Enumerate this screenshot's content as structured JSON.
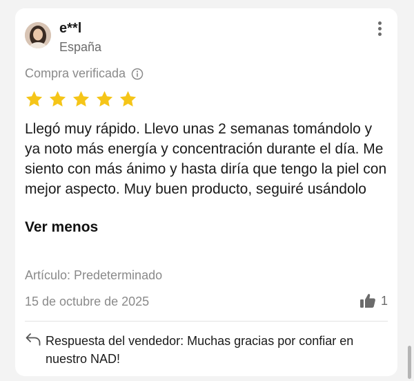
{
  "review": {
    "username": "e**l",
    "country": "España",
    "verified_label": "Compra verificada",
    "rating": 5,
    "rating_max": 5,
    "text": "Llegó muy rápido. Llevo unas 2 semanas tomándolo y ya noto más energía y concentración durante el día. Me siento con más ánimo y hasta diría que tengo la piel con mejor aspecto. Muy buen producto, seguiré usándolo",
    "toggle_label": "Ver menos",
    "article": "Artículo: Predeterminado",
    "date": "15 de octubre de 2025",
    "helpful_count": "1",
    "seller_reply": "Respuesta del vendedor: Muchas gracias por confiar en nuestro NAD!"
  },
  "colors": {
    "star": "#f5c518",
    "muted_text": "#8a8a8a",
    "card_bg": "#ffffff",
    "page_bg": "#f3f3f3"
  },
  "icons": {
    "more": "more-vertical-icon",
    "info": "info-icon",
    "star": "star-icon",
    "thumb": "thumbs-up-icon",
    "reply": "reply-arrow-icon"
  }
}
